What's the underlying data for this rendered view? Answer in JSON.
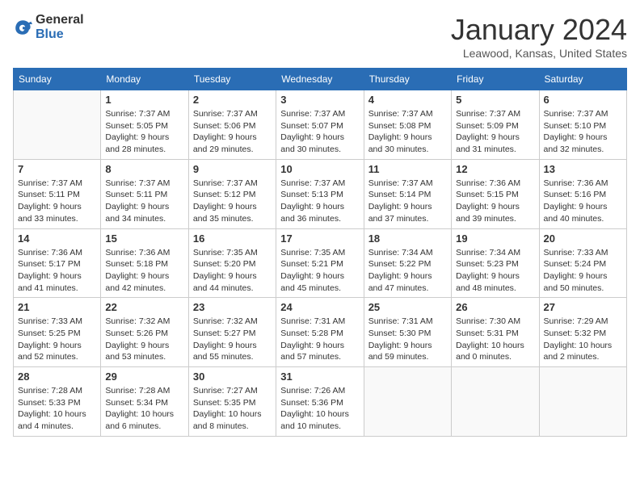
{
  "logo": {
    "general": "General",
    "blue": "Blue"
  },
  "title": "January 2024",
  "location": "Leawood, Kansas, United States",
  "days_of_week": [
    "Sunday",
    "Monday",
    "Tuesday",
    "Wednesday",
    "Thursday",
    "Friday",
    "Saturday"
  ],
  "weeks": [
    [
      {
        "day": "",
        "info": ""
      },
      {
        "day": "1",
        "info": "Sunrise: 7:37 AM\nSunset: 5:05 PM\nDaylight: 9 hours\nand 28 minutes."
      },
      {
        "day": "2",
        "info": "Sunrise: 7:37 AM\nSunset: 5:06 PM\nDaylight: 9 hours\nand 29 minutes."
      },
      {
        "day": "3",
        "info": "Sunrise: 7:37 AM\nSunset: 5:07 PM\nDaylight: 9 hours\nand 30 minutes."
      },
      {
        "day": "4",
        "info": "Sunrise: 7:37 AM\nSunset: 5:08 PM\nDaylight: 9 hours\nand 30 minutes."
      },
      {
        "day": "5",
        "info": "Sunrise: 7:37 AM\nSunset: 5:09 PM\nDaylight: 9 hours\nand 31 minutes."
      },
      {
        "day": "6",
        "info": "Sunrise: 7:37 AM\nSunset: 5:10 PM\nDaylight: 9 hours\nand 32 minutes."
      }
    ],
    [
      {
        "day": "7",
        "info": "Sunrise: 7:37 AM\nSunset: 5:11 PM\nDaylight: 9 hours\nand 33 minutes."
      },
      {
        "day": "8",
        "info": "Sunrise: 7:37 AM\nSunset: 5:11 PM\nDaylight: 9 hours\nand 34 minutes."
      },
      {
        "day": "9",
        "info": "Sunrise: 7:37 AM\nSunset: 5:12 PM\nDaylight: 9 hours\nand 35 minutes."
      },
      {
        "day": "10",
        "info": "Sunrise: 7:37 AM\nSunset: 5:13 PM\nDaylight: 9 hours\nand 36 minutes."
      },
      {
        "day": "11",
        "info": "Sunrise: 7:37 AM\nSunset: 5:14 PM\nDaylight: 9 hours\nand 37 minutes."
      },
      {
        "day": "12",
        "info": "Sunrise: 7:36 AM\nSunset: 5:15 PM\nDaylight: 9 hours\nand 39 minutes."
      },
      {
        "day": "13",
        "info": "Sunrise: 7:36 AM\nSunset: 5:16 PM\nDaylight: 9 hours\nand 40 minutes."
      }
    ],
    [
      {
        "day": "14",
        "info": "Sunrise: 7:36 AM\nSunset: 5:17 PM\nDaylight: 9 hours\nand 41 minutes."
      },
      {
        "day": "15",
        "info": "Sunrise: 7:36 AM\nSunset: 5:18 PM\nDaylight: 9 hours\nand 42 minutes."
      },
      {
        "day": "16",
        "info": "Sunrise: 7:35 AM\nSunset: 5:20 PM\nDaylight: 9 hours\nand 44 minutes."
      },
      {
        "day": "17",
        "info": "Sunrise: 7:35 AM\nSunset: 5:21 PM\nDaylight: 9 hours\nand 45 minutes."
      },
      {
        "day": "18",
        "info": "Sunrise: 7:34 AM\nSunset: 5:22 PM\nDaylight: 9 hours\nand 47 minutes."
      },
      {
        "day": "19",
        "info": "Sunrise: 7:34 AM\nSunset: 5:23 PM\nDaylight: 9 hours\nand 48 minutes."
      },
      {
        "day": "20",
        "info": "Sunrise: 7:33 AM\nSunset: 5:24 PM\nDaylight: 9 hours\nand 50 minutes."
      }
    ],
    [
      {
        "day": "21",
        "info": "Sunrise: 7:33 AM\nSunset: 5:25 PM\nDaylight: 9 hours\nand 52 minutes."
      },
      {
        "day": "22",
        "info": "Sunrise: 7:32 AM\nSunset: 5:26 PM\nDaylight: 9 hours\nand 53 minutes."
      },
      {
        "day": "23",
        "info": "Sunrise: 7:32 AM\nSunset: 5:27 PM\nDaylight: 9 hours\nand 55 minutes."
      },
      {
        "day": "24",
        "info": "Sunrise: 7:31 AM\nSunset: 5:28 PM\nDaylight: 9 hours\nand 57 minutes."
      },
      {
        "day": "25",
        "info": "Sunrise: 7:31 AM\nSunset: 5:30 PM\nDaylight: 9 hours\nand 59 minutes."
      },
      {
        "day": "26",
        "info": "Sunrise: 7:30 AM\nSunset: 5:31 PM\nDaylight: 10 hours\nand 0 minutes."
      },
      {
        "day": "27",
        "info": "Sunrise: 7:29 AM\nSunset: 5:32 PM\nDaylight: 10 hours\nand 2 minutes."
      }
    ],
    [
      {
        "day": "28",
        "info": "Sunrise: 7:28 AM\nSunset: 5:33 PM\nDaylight: 10 hours\nand 4 minutes."
      },
      {
        "day": "29",
        "info": "Sunrise: 7:28 AM\nSunset: 5:34 PM\nDaylight: 10 hours\nand 6 minutes."
      },
      {
        "day": "30",
        "info": "Sunrise: 7:27 AM\nSunset: 5:35 PM\nDaylight: 10 hours\nand 8 minutes."
      },
      {
        "day": "31",
        "info": "Sunrise: 7:26 AM\nSunset: 5:36 PM\nDaylight: 10 hours\nand 10 minutes."
      },
      {
        "day": "",
        "info": ""
      },
      {
        "day": "",
        "info": ""
      },
      {
        "day": "",
        "info": ""
      }
    ]
  ]
}
